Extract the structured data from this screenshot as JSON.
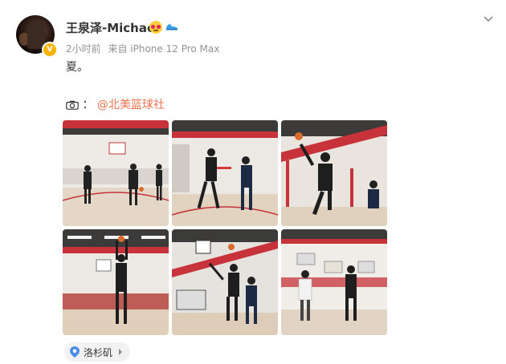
{
  "post": {
    "author": "王泉泽-Michael",
    "time": "2小时前",
    "source": "来自 iPhone 12 Pro Max",
    "text": "夏。",
    "photo_credit_label": "：",
    "mention": "@北美篮球社",
    "location": "洛杉矶"
  },
  "icons": {
    "avatar_badge": "verified-badge-icon",
    "emoji": "heart-eyes-emoji-icon",
    "shoe": "sneaker-icon",
    "more": "chevron-down-icon",
    "camera": "camera-icon",
    "location": "location-pin-icon",
    "location_arrow": "chevron-right-icon"
  },
  "colors": {
    "mention": "#eb7350",
    "location_pin": "#4a8ce8",
    "badge": "#f6b400",
    "court_red": "#c8323a"
  },
  "photos": [
    {
      "subject": "basketball-photo-1"
    },
    {
      "subject": "basketball-photo-2"
    },
    {
      "subject": "basketball-photo-3"
    },
    {
      "subject": "basketball-photo-4"
    },
    {
      "subject": "basketball-photo-5"
    },
    {
      "subject": "basketball-photo-6"
    }
  ]
}
